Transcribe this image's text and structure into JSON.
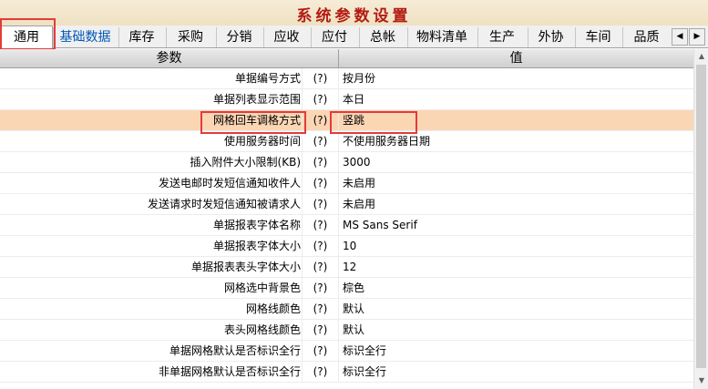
{
  "window": {
    "title": "系统参数设置"
  },
  "tabs": [
    {
      "label": "通用",
      "active": true
    },
    {
      "label": "基础数据",
      "link": true
    },
    {
      "label": "库存"
    },
    {
      "label": "采购"
    },
    {
      "label": "分销"
    },
    {
      "label": "应收"
    },
    {
      "label": "应付"
    },
    {
      "label": "总帐"
    },
    {
      "label": "物料清单"
    },
    {
      "label": "生产"
    },
    {
      "label": "外协"
    },
    {
      "label": "车间"
    },
    {
      "label": "品质"
    }
  ],
  "tab_scroll": {
    "left": "◀",
    "right": "▶"
  },
  "grid": {
    "columns": {
      "param": "参数",
      "value": "值"
    },
    "rows": [
      {
        "name": "单据编号方式",
        "help": "(?)",
        "value": "按月份"
      },
      {
        "name": "单据列表显示范围",
        "help": "(?)",
        "value": "本日"
      },
      {
        "name": "网格回车调格方式",
        "help": "(?)",
        "value": "竖跳",
        "selected": true
      },
      {
        "name": "使用服务器时间",
        "help": "(?)",
        "value": "不使用服务器日期"
      },
      {
        "name": "插入附件大小限制(KB)",
        "help": "(?)",
        "value": "3000"
      },
      {
        "name": "发送电邮时发短信通知收件人",
        "help": "(?)",
        "value": "未启用"
      },
      {
        "name": "发送请求时发短信通知被请求人",
        "help": "(?)",
        "value": "未启用"
      },
      {
        "name": "单据报表字体名称",
        "help": "(?)",
        "value": "MS Sans Serif"
      },
      {
        "name": "单据报表字体大小",
        "help": "(?)",
        "value": "10"
      },
      {
        "name": "单据报表表头字体大小",
        "help": "(?)",
        "value": "12"
      },
      {
        "name": "网格选中背景色",
        "help": "(?)",
        "value": "棕色"
      },
      {
        "name": "网格线颜色",
        "help": "(?)",
        "value": "默认"
      },
      {
        "name": "表头网格线颜色",
        "help": "(?)",
        "value": "默认"
      },
      {
        "name": "单据网格默认是否标识全行",
        "help": "(?)",
        "value": "标识全行"
      },
      {
        "name": "非单据网格默认是否标识全行",
        "help": "(?)",
        "value": "标识全行"
      }
    ]
  },
  "scrollbar": {
    "up": "▲",
    "down": "▼"
  },
  "colors": {
    "title": "#b31b12",
    "selected_row": "#fbd6b5",
    "highlight_box": "#e33b3b",
    "link_tab": "#0057b8"
  }
}
